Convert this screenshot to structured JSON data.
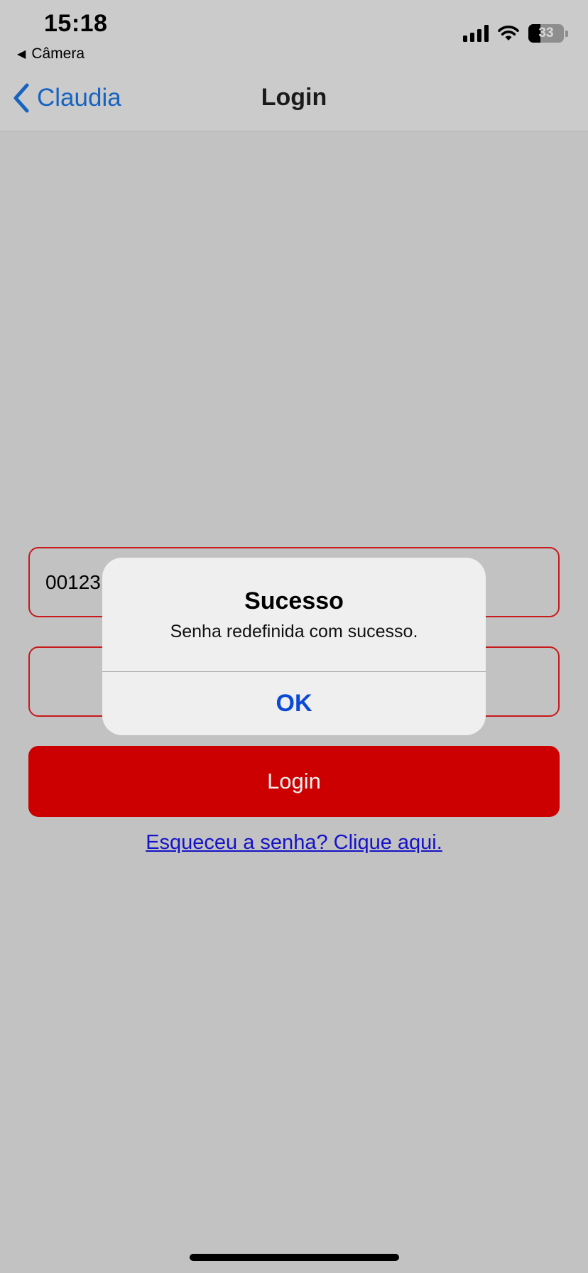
{
  "status_bar": {
    "time": "15:18",
    "back_app_label": "Câmera",
    "back_app_icon": "left-triangle-icon",
    "battery_level": "33",
    "icons": [
      "cellular-signal-icon",
      "wifi-icon",
      "battery-icon"
    ]
  },
  "nav": {
    "back_label": "Claudia",
    "back_icon": "chevron-left-icon",
    "title": "Login",
    "accent_color": "#1763c0"
  },
  "form": {
    "username_value": "00123",
    "password_value": "",
    "login_button_label": "Login",
    "login_button_color": "#cc0000",
    "field_border_color": "#c8191c",
    "forgot_link": "Esqueceu a senha? Clique aqui."
  },
  "alert": {
    "title": "Sucesso",
    "message": "Senha redefinida com sucesso.",
    "ok_label": "OK",
    "ok_color": "#0b4ad6"
  }
}
